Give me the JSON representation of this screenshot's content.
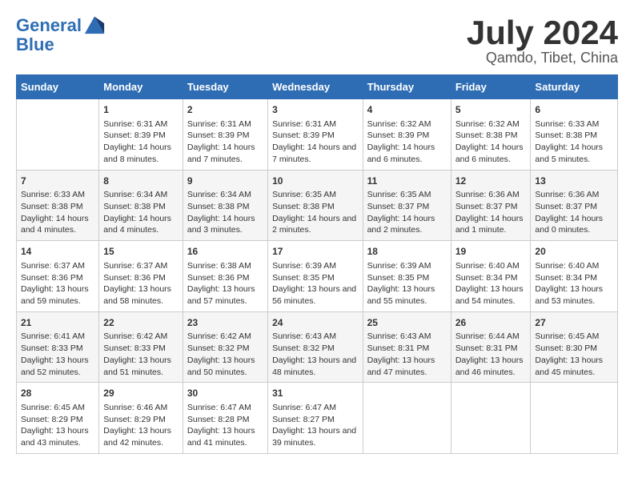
{
  "header": {
    "logo_line1": "General",
    "logo_line2": "Blue",
    "month": "July 2024",
    "location": "Qamdo, Tibet, China"
  },
  "days_of_week": [
    "Sunday",
    "Monday",
    "Tuesday",
    "Wednesday",
    "Thursday",
    "Friday",
    "Saturday"
  ],
  "weeks": [
    [
      {
        "day": "",
        "sunrise": "",
        "sunset": "",
        "daylight": ""
      },
      {
        "day": "1",
        "sunrise": "Sunrise: 6:31 AM",
        "sunset": "Sunset: 8:39 PM",
        "daylight": "Daylight: 14 hours and 8 minutes."
      },
      {
        "day": "2",
        "sunrise": "Sunrise: 6:31 AM",
        "sunset": "Sunset: 8:39 PM",
        "daylight": "Daylight: 14 hours and 7 minutes."
      },
      {
        "day": "3",
        "sunrise": "Sunrise: 6:31 AM",
        "sunset": "Sunset: 8:39 PM",
        "daylight": "Daylight: 14 hours and 7 minutes."
      },
      {
        "day": "4",
        "sunrise": "Sunrise: 6:32 AM",
        "sunset": "Sunset: 8:39 PM",
        "daylight": "Daylight: 14 hours and 6 minutes."
      },
      {
        "day": "5",
        "sunrise": "Sunrise: 6:32 AM",
        "sunset": "Sunset: 8:38 PM",
        "daylight": "Daylight: 14 hours and 6 minutes."
      },
      {
        "day": "6",
        "sunrise": "Sunrise: 6:33 AM",
        "sunset": "Sunset: 8:38 PM",
        "daylight": "Daylight: 14 hours and 5 minutes."
      }
    ],
    [
      {
        "day": "7",
        "sunrise": "Sunrise: 6:33 AM",
        "sunset": "Sunset: 8:38 PM",
        "daylight": "Daylight: 14 hours and 4 minutes."
      },
      {
        "day": "8",
        "sunrise": "Sunrise: 6:34 AM",
        "sunset": "Sunset: 8:38 PM",
        "daylight": "Daylight: 14 hours and 4 minutes."
      },
      {
        "day": "9",
        "sunrise": "Sunrise: 6:34 AM",
        "sunset": "Sunset: 8:38 PM",
        "daylight": "Daylight: 14 hours and 3 minutes."
      },
      {
        "day": "10",
        "sunrise": "Sunrise: 6:35 AM",
        "sunset": "Sunset: 8:38 PM",
        "daylight": "Daylight: 14 hours and 2 minutes."
      },
      {
        "day": "11",
        "sunrise": "Sunrise: 6:35 AM",
        "sunset": "Sunset: 8:37 PM",
        "daylight": "Daylight: 14 hours and 2 minutes."
      },
      {
        "day": "12",
        "sunrise": "Sunrise: 6:36 AM",
        "sunset": "Sunset: 8:37 PM",
        "daylight": "Daylight: 14 hours and 1 minute."
      },
      {
        "day": "13",
        "sunrise": "Sunrise: 6:36 AM",
        "sunset": "Sunset: 8:37 PM",
        "daylight": "Daylight: 14 hours and 0 minutes."
      }
    ],
    [
      {
        "day": "14",
        "sunrise": "Sunrise: 6:37 AM",
        "sunset": "Sunset: 8:36 PM",
        "daylight": "Daylight: 13 hours and 59 minutes."
      },
      {
        "day": "15",
        "sunrise": "Sunrise: 6:37 AM",
        "sunset": "Sunset: 8:36 PM",
        "daylight": "Daylight: 13 hours and 58 minutes."
      },
      {
        "day": "16",
        "sunrise": "Sunrise: 6:38 AM",
        "sunset": "Sunset: 8:36 PM",
        "daylight": "Daylight: 13 hours and 57 minutes."
      },
      {
        "day": "17",
        "sunrise": "Sunrise: 6:39 AM",
        "sunset": "Sunset: 8:35 PM",
        "daylight": "Daylight: 13 hours and 56 minutes."
      },
      {
        "day": "18",
        "sunrise": "Sunrise: 6:39 AM",
        "sunset": "Sunset: 8:35 PM",
        "daylight": "Daylight: 13 hours and 55 minutes."
      },
      {
        "day": "19",
        "sunrise": "Sunrise: 6:40 AM",
        "sunset": "Sunset: 8:34 PM",
        "daylight": "Daylight: 13 hours and 54 minutes."
      },
      {
        "day": "20",
        "sunrise": "Sunrise: 6:40 AM",
        "sunset": "Sunset: 8:34 PM",
        "daylight": "Daylight: 13 hours and 53 minutes."
      }
    ],
    [
      {
        "day": "21",
        "sunrise": "Sunrise: 6:41 AM",
        "sunset": "Sunset: 8:33 PM",
        "daylight": "Daylight: 13 hours and 52 minutes."
      },
      {
        "day": "22",
        "sunrise": "Sunrise: 6:42 AM",
        "sunset": "Sunset: 8:33 PM",
        "daylight": "Daylight: 13 hours and 51 minutes."
      },
      {
        "day": "23",
        "sunrise": "Sunrise: 6:42 AM",
        "sunset": "Sunset: 8:32 PM",
        "daylight": "Daylight: 13 hours and 50 minutes."
      },
      {
        "day": "24",
        "sunrise": "Sunrise: 6:43 AM",
        "sunset": "Sunset: 8:32 PM",
        "daylight": "Daylight: 13 hours and 48 minutes."
      },
      {
        "day": "25",
        "sunrise": "Sunrise: 6:43 AM",
        "sunset": "Sunset: 8:31 PM",
        "daylight": "Daylight: 13 hours and 47 minutes."
      },
      {
        "day": "26",
        "sunrise": "Sunrise: 6:44 AM",
        "sunset": "Sunset: 8:31 PM",
        "daylight": "Daylight: 13 hours and 46 minutes."
      },
      {
        "day": "27",
        "sunrise": "Sunrise: 6:45 AM",
        "sunset": "Sunset: 8:30 PM",
        "daylight": "Daylight: 13 hours and 45 minutes."
      }
    ],
    [
      {
        "day": "28",
        "sunrise": "Sunrise: 6:45 AM",
        "sunset": "Sunset: 8:29 PM",
        "daylight": "Daylight: 13 hours and 43 minutes."
      },
      {
        "day": "29",
        "sunrise": "Sunrise: 6:46 AM",
        "sunset": "Sunset: 8:29 PM",
        "daylight": "Daylight: 13 hours and 42 minutes."
      },
      {
        "day": "30",
        "sunrise": "Sunrise: 6:47 AM",
        "sunset": "Sunset: 8:28 PM",
        "daylight": "Daylight: 13 hours and 41 minutes."
      },
      {
        "day": "31",
        "sunrise": "Sunrise: 6:47 AM",
        "sunset": "Sunset: 8:27 PM",
        "daylight": "Daylight: 13 hours and 39 minutes."
      },
      {
        "day": "",
        "sunrise": "",
        "sunset": "",
        "daylight": ""
      },
      {
        "day": "",
        "sunrise": "",
        "sunset": "",
        "daylight": ""
      },
      {
        "day": "",
        "sunrise": "",
        "sunset": "",
        "daylight": ""
      }
    ]
  ]
}
